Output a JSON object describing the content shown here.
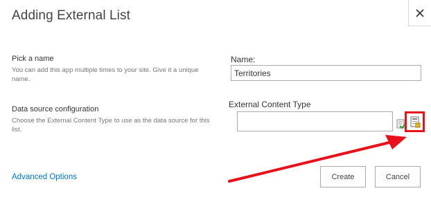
{
  "dialog": {
    "title": "Adding External List",
    "close_label": "×"
  },
  "name_section": {
    "title": "Pick a name",
    "description": "You can add this app multiple times to your site. Give it a unique name.",
    "field_label": "Name:",
    "field_value": "Territories"
  },
  "data_source_section": {
    "title": "Data source configuration",
    "description": "Choose the External Content Type to use as the data source for this list.",
    "field_label": "External Content Type",
    "field_value": "",
    "icons": [
      "check-names-icon",
      "browse-external-content-types-icon"
    ]
  },
  "footer": {
    "advanced_link": "Advanced Options",
    "create_label": "Create",
    "cancel_label": "Cancel"
  },
  "annotation": {
    "color": "#e8101b"
  },
  "colors": {
    "link": "#0072c6",
    "text": "#444444",
    "muted": "#777777",
    "border": "#ababab"
  }
}
